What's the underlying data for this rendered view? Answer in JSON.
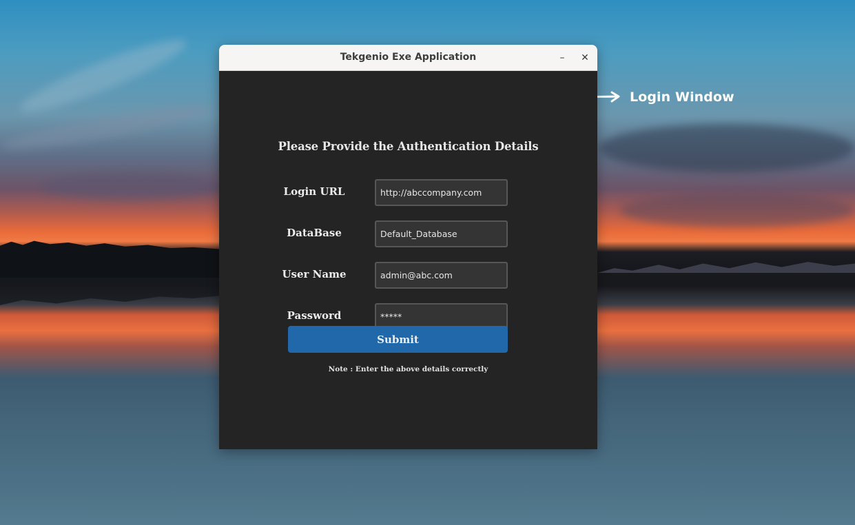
{
  "annotation": {
    "label": "Login Window"
  },
  "window": {
    "title": "Tekgenio Exe Application",
    "minimize_icon": "minimize-icon",
    "close_icon": "close-icon",
    "minimize_glyph": "–",
    "close_glyph": "✕"
  },
  "form": {
    "heading": "Please Provide the Authentication Details",
    "fields": [
      {
        "label": "Login URL",
        "value": "http://abccompany.com"
      },
      {
        "label": "DataBase",
        "value": "Default_Database"
      },
      {
        "label": "User Name",
        "value": "admin@abc.com"
      },
      {
        "label": "Password",
        "value": "*****"
      }
    ],
    "submit_label": "Submit",
    "note": "Note : Enter the above details correctly"
  },
  "colors": {
    "window_background": "#242424",
    "titlebar_background": "#f6f5f4",
    "input_background": "#343434",
    "submit_button": "#2068aa"
  }
}
